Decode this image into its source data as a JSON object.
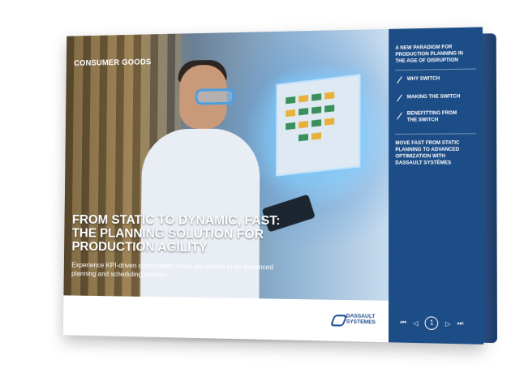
{
  "cover": {
    "category": "CONSUMER GOODS",
    "title_line1": "FROM STATIC TO DYNAMIC, FAST:",
    "title_line2": "THE PLANNING SOLUTION FOR",
    "title_line3": "PRODUCTION AGILITY",
    "subtitle_line1": "Experience KPI-driven optimization when you switch to an advanced",
    "subtitle_line2": "planning and scheduling solution."
  },
  "sidebar": {
    "items": [
      {
        "line1": "A NEW PARADIGM FOR",
        "line2": "PRODUCTION PLANNING IN",
        "line3": "THE AGE OF DISRUPTION"
      },
      {
        "line1": "WHY SWITCH"
      },
      {
        "line1": "MAKING THE SWITCH"
      },
      {
        "line1": "BENEFITTING FROM",
        "line2": "THE SWITCH"
      },
      {
        "line1": "MOVE FAST FROM STATIC",
        "line2": "PLANNING TO ADVANCED",
        "line3": "OPTIMIZATION WITH",
        "line4": "DASSAULT SYSTÈMES"
      }
    ],
    "nav": {
      "first": "⏮",
      "prev": "◁",
      "page": "1",
      "next": "▷",
      "last": "⏭"
    }
  },
  "logo": {
    "line1": "DASSAULT",
    "line2": "SYSTEMES"
  },
  "colors": {
    "sidebar": "#1d4d86",
    "accent": "#4aa0e0",
    "logo": "#1b4b8f"
  }
}
